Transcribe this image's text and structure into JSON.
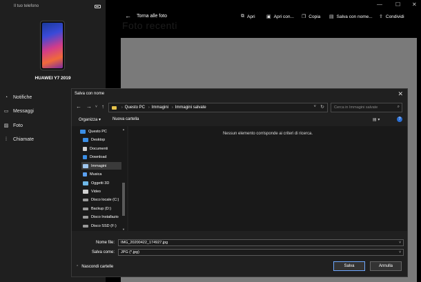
{
  "sidebar": {
    "app_title": "Il tuo telefono",
    "device_name": "HUAWEI Y7 2019",
    "items": [
      {
        "label": "Notifiche",
        "icon": "bell-icon"
      },
      {
        "label": "Messaggi",
        "icon": "chat-icon"
      },
      {
        "label": "Foto",
        "icon": "photo-icon"
      },
      {
        "label": "Chiamate",
        "icon": "grid-icon"
      }
    ]
  },
  "toolbar": {
    "back_label": "Torna alle foto",
    "faded_title": "Foto recenti",
    "buttons": [
      {
        "label": "Apri",
        "icon": "open-icon"
      },
      {
        "label": "Apri con...",
        "icon": "open-with-icon"
      },
      {
        "label": "Copia",
        "icon": "copy-icon"
      },
      {
        "label": "Salva con nome...",
        "icon": "save-icon"
      },
      {
        "label": "Condividi",
        "icon": "share-icon"
      }
    ]
  },
  "dialog": {
    "title": "Salva con nome",
    "path": [
      "Questo PC",
      "Immagini",
      "Immagini salvate"
    ],
    "search_placeholder": "Cerca in Immagini salvate",
    "organize_label": "Organizza ▾",
    "new_folder_label": "Nuova cartella",
    "empty_message": "Nessun elemento corrisponde ai criteri di ricerca.",
    "tree": [
      {
        "label": "Questo PC",
        "icon": "computer-icon",
        "color": "#3a8ee6"
      },
      {
        "label": "Desktop",
        "icon": "desktop-icon",
        "color": "#3a8ee6"
      },
      {
        "label": "Documenti",
        "icon": "documents-icon",
        "color": "#d0d0d0"
      },
      {
        "label": "Download",
        "icon": "download-icon",
        "color": "#3a8ee6"
      },
      {
        "label": "Immagini",
        "icon": "pictures-icon",
        "color": "#9fc6ee"
      },
      {
        "label": "Musica",
        "icon": "music-icon",
        "color": "#5aa0f0"
      },
      {
        "label": "Oggetti 3D",
        "icon": "objects3d-icon",
        "color": "#6fb8e8"
      },
      {
        "label": "Video",
        "icon": "video-icon",
        "color": "#cfcfcf"
      },
      {
        "label": "Disco locale (C:)",
        "icon": "drive-icon",
        "color": "#9a9a9a"
      },
      {
        "label": "Backup (D:)",
        "icon": "drive-icon",
        "color": "#9a9a9a"
      },
      {
        "label": "Disco Installazio",
        "icon": "drive-icon",
        "color": "#9a9a9a"
      },
      {
        "label": "Disco SSD (F:)",
        "icon": "drive-icon",
        "color": "#9a9a9a"
      }
    ],
    "filename_label": "Nome file:",
    "filename_value": "IMG_20200422_174927.jpg",
    "savetype_label": "Salva come:",
    "savetype_value": "JPG (*.jpg)",
    "hide_folders_label": "Nascondi cartelle",
    "save_label": "Salva",
    "cancel_label": "Annulla"
  }
}
